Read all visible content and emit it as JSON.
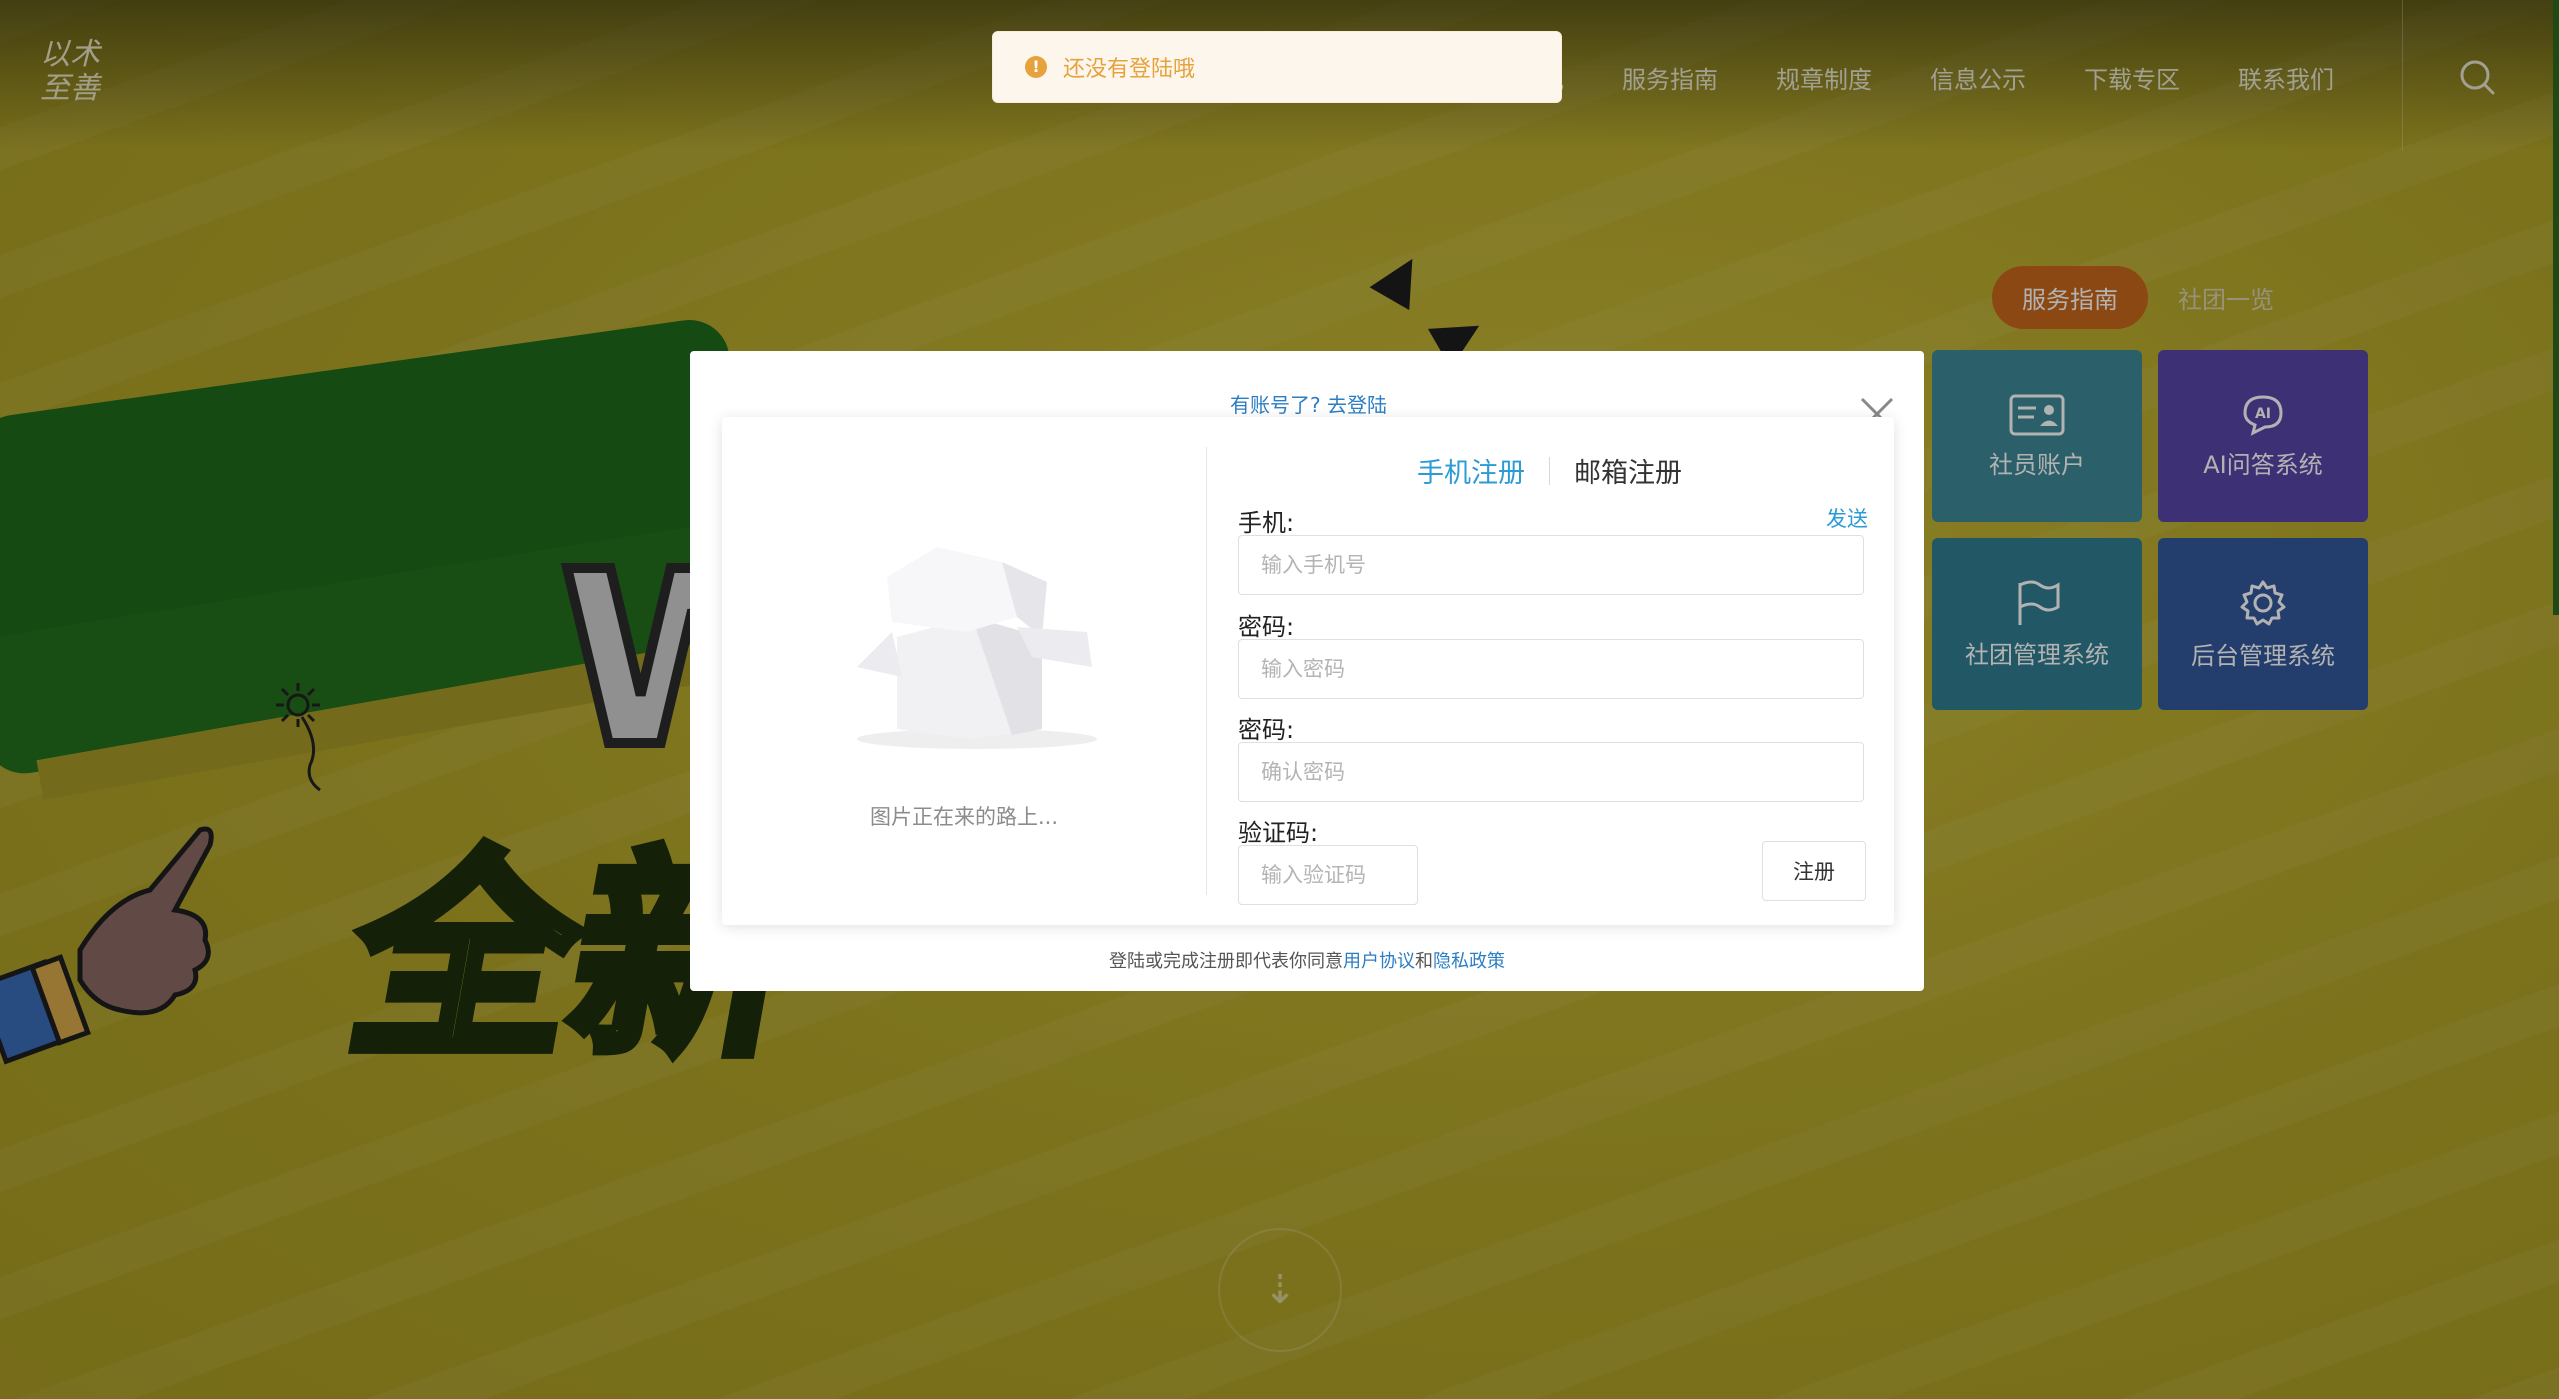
{
  "header": {
    "nav": [
      "况",
      "服务指南",
      "规章制度",
      "信息公示",
      "下载专区",
      "联系我们"
    ],
    "logo_text": "以术至善"
  },
  "hero": {
    "letters": "W",
    "cn": "全新"
  },
  "services": {
    "tabs": [
      "服务指南",
      "社团一览"
    ],
    "tiles": [
      {
        "label": "社员账户",
        "icon": "id-card-icon",
        "color": "#3e6f78"
      },
      {
        "label": "AI问答系统",
        "icon": "ai-chat-icon",
        "color": "#473a82"
      },
      {
        "label": "社团管理系统",
        "icon": "flag-icon",
        "color": "#2d6472"
      },
      {
        "label": "后台管理系统",
        "icon": "gear-icon",
        "color": "#2a4a78"
      }
    ]
  },
  "toast": {
    "icon": "warning-icon",
    "text": "还没有登陆哦"
  },
  "modal": {
    "have_account": "有账号了? 去登陆",
    "image_caption": "图片正在来的路上...",
    "tabs": {
      "phone": "手机注册",
      "email": "邮箱注册"
    },
    "phone_label": "手机:",
    "send_label": "发送",
    "phone_placeholder": "输入手机号",
    "password_label": "密码:",
    "password_placeholder": "输入密码",
    "confirm_label": "密码:",
    "confirm_placeholder": "确认密码",
    "code_label": "验证码:",
    "code_placeholder": "输入验证码",
    "register_label": "注册",
    "agree_prefix": "登陆或完成注册即代表你同意",
    "agree_terms": "用户协议",
    "agree_and": "和",
    "agree_privacy": "隐私政策"
  }
}
